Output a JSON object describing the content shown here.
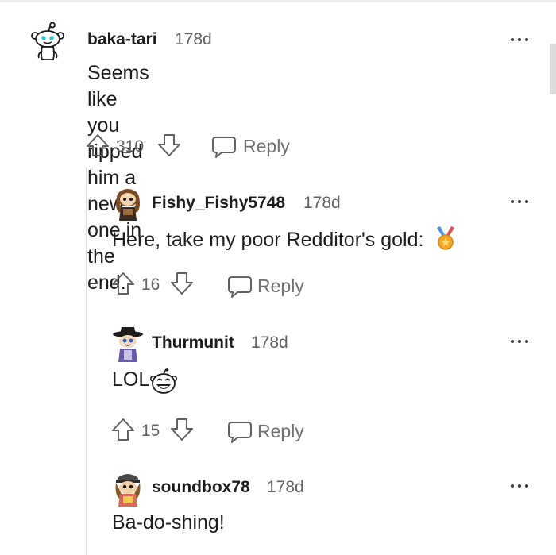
{
  "comments": [
    {
      "username": "baka-tari",
      "age": "178d",
      "body_line1": "Seems like you ripped him a new one in the",
      "body_line2": "end.",
      "score": "310",
      "reply_label": "Reply",
      "avatar_icon": "snoo-default-avatar"
    },
    {
      "username": "Fishy_Fishy5748",
      "age": "178d",
      "body": "Here, take my poor Redditor's gold:",
      "body_emoji": "medal-icon",
      "score": "16",
      "reply_label": "Reply",
      "avatar_icon": "snoo-brown-hair-avatar"
    },
    {
      "username": "Thurmunit",
      "age": "178d",
      "body": "LOL",
      "body_emoji": "laughing-snoo-emoji",
      "score": "15",
      "reply_label": "Reply",
      "avatar_icon": "snoo-hat-avatar"
    },
    {
      "username": "soundbox78",
      "age": "178d",
      "body": "Ba-do-shing!",
      "avatar_icon": "snoo-cap-avatar"
    }
  ],
  "colors": {
    "text": "#1c1c1c",
    "meta": "#616161",
    "reply": "#707070",
    "thread_line": "#d9d9d9",
    "medal": "#f5a623"
  }
}
